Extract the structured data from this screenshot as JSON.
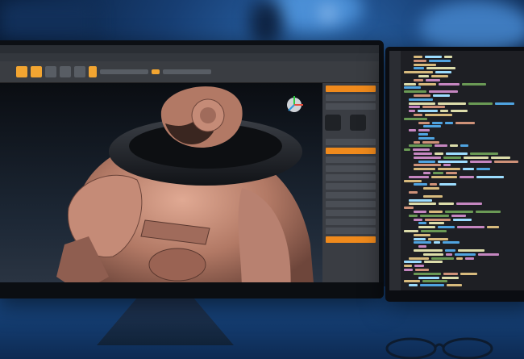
{
  "photo": {
    "subject": "workstation",
    "palette": {
      "ambient": "#1a4a8a",
      "accent": "#f2a531",
      "skin": "#b97f6b"
    }
  },
  "left_monitor": {
    "app": "3d-sculpting",
    "toolbar_icons": [
      "brush-icon",
      "move-icon",
      "scale-icon",
      "rotate-icon",
      "draw-icon"
    ]
  },
  "right_monitor": {
    "app": "code-editor"
  }
}
